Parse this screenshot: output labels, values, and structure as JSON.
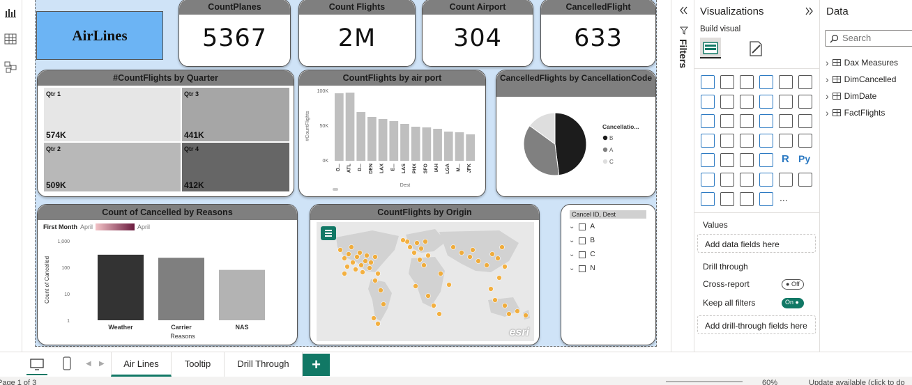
{
  "report": {
    "logo_text": "AirLines",
    "kpis": [
      {
        "label": "CountPlanes",
        "value": "5367"
      },
      {
        "label": "Count Flights",
        "value": "2M"
      },
      {
        "label": "Count Airport",
        "value": "304"
      },
      {
        "label": "CancelledFlight",
        "value": "633"
      }
    ],
    "treemap": {
      "title": "#CountFlights by Quarter",
      "cells": [
        {
          "label": "Qtr 1",
          "value": "574K",
          "color": "#e6e6e6"
        },
        {
          "label": "Qtr 3",
          "value": "441K",
          "color": "#a6a6a6"
        },
        {
          "label": "Qtr 2",
          "value": "509K",
          "color": "#b8b8b8"
        },
        {
          "label": "Qtr 4",
          "value": "412K",
          "color": "#666666"
        }
      ]
    },
    "pie_title": "CancelledFlights by CancellationCode",
    "pie_legend_title": "Cancellatio...",
    "reasons_filter": {
      "label": "First Month",
      "from": "April",
      "to": "April"
    },
    "map": {
      "title": "CountFlights by Origin",
      "watermark": "esri",
      "menu_icon": "hamburger-icon"
    },
    "slicer": {
      "header": "Cancel ID, Dest",
      "items": [
        "A",
        "B",
        "C",
        "N"
      ]
    }
  },
  "chart_data": [
    {
      "type": "bar",
      "title": "CountFlights by air port",
      "xlabel": "Dest",
      "ylabel": "#CountFlights",
      "ylim": [
        0,
        100000
      ],
      "yticks": [
        "0K",
        "50K",
        "100K"
      ],
      "categories": [
        "O...",
        "ATL",
        "D...",
        "DEN",
        "LAX",
        "E...",
        "LAS",
        "PHX",
        "SFO",
        "IAH",
        "LGA",
        "M...",
        "JFK"
      ],
      "values": [
        97000,
        98000,
        70000,
        63000,
        60000,
        57000,
        53000,
        49000,
        48000,
        46000,
        42000,
        41000,
        38000
      ],
      "color": "#bfbfbf"
    },
    {
      "type": "pie",
      "title": "CancelledFlights by CancellationCode",
      "legend_title": "Cancellatio...",
      "categories": [
        "B",
        "A",
        "C"
      ],
      "values": [
        48,
        37,
        15
      ],
      "colors": [
        "#1c1c1c",
        "#808080",
        "#dedede"
      ]
    },
    {
      "type": "bar",
      "title": "Count of Cancelled by Reasons",
      "xlabel": "Reasons",
      "ylabel": "Count of Cancelled",
      "yscale": "log",
      "ylim": [
        1,
        1000
      ],
      "yticks": [
        "1",
        "10",
        "100",
        "1,000"
      ],
      "categories": [
        "Weather",
        "Carrier",
        "NAS"
      ],
      "values": [
        300,
        230,
        80
      ],
      "colors": [
        "#333333",
        "#7f7f7f",
        "#b3b3b3"
      ]
    }
  ],
  "filters_label": "Filters",
  "viz_pane": {
    "title": "Visualizations",
    "build_visual": "Build visual",
    "values_label": "Values",
    "values_well": "Add data fields here",
    "drill_through": "Drill through",
    "cross_report": "Cross-report",
    "cross_report_state": "Off",
    "keep_filters": "Keep all filters",
    "keep_filters_state": "On",
    "drill_well": "Add drill-through fields here",
    "more": "..."
  },
  "data_pane": {
    "title": "Data",
    "search_placeholder": "Search",
    "tables": [
      "Dax Measures",
      "DimCancelled",
      "DimDate",
      "FactFlights"
    ]
  },
  "tabs": [
    "Air Lines",
    "Tooltip",
    "Drill Through"
  ],
  "add_tab": "+",
  "status": {
    "page": "Page 1 of 3",
    "zoom": "60%",
    "update": "Update available (click to do"
  },
  "colors": {
    "accent": "#117865",
    "report_bg": "#cfe3f7",
    "logo_bg": "#6cb4f4",
    "map_point": "#f5a623"
  }
}
